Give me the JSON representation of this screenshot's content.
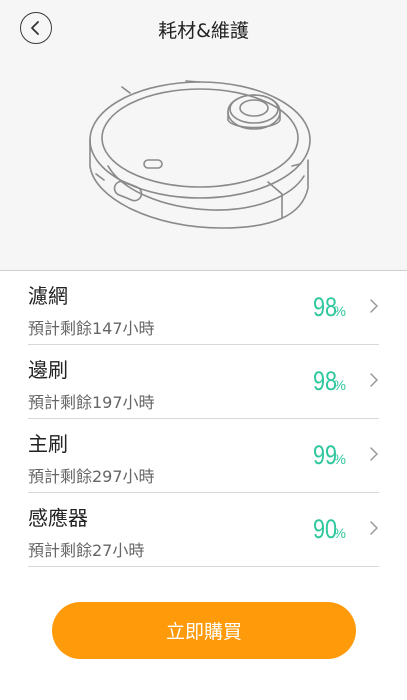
{
  "header": {
    "title": "耗材&維護"
  },
  "items": [
    {
      "name": "濾網",
      "remaining": "預計剩餘147小時",
      "percent": "98",
      "unit": "%"
    },
    {
      "name": "邊刷",
      "remaining": "預計剩餘197小時",
      "percent": "98",
      "unit": "%"
    },
    {
      "name": "主刷",
      "remaining": "預計剩餘297小時",
      "percent": "99",
      "unit": "%"
    },
    {
      "name": "感應器",
      "remaining": "預計剩餘27小時",
      "percent": "90",
      "unit": "%"
    }
  ],
  "buy_button": {
    "label": "立即購買"
  },
  "colors": {
    "accent": "#2fc79d",
    "button": "#ff9a0a",
    "header_bg": "#f6f6f6"
  }
}
